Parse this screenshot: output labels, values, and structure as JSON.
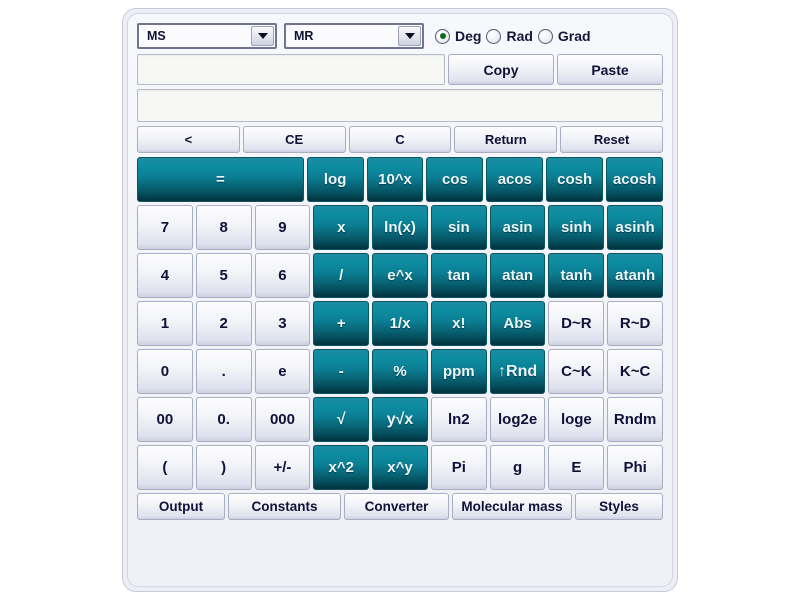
{
  "memory": {
    "store_select": {
      "value": "MS",
      "icon": "chevron-down-icon"
    },
    "recall_select": {
      "value": "MR",
      "icon": "chevron-down-icon"
    }
  },
  "angle_mode": {
    "selected": "Deg",
    "options": [
      {
        "label": "Deg",
        "selected": true
      },
      {
        "label": "Rad",
        "selected": false
      },
      {
        "label": "Grad",
        "selected": false
      }
    ]
  },
  "display": {
    "expression_value": "",
    "expression_placeholder": "",
    "result_value": "",
    "result_placeholder": ""
  },
  "clipboard": {
    "copy_label": "Copy",
    "paste_label": "Paste"
  },
  "edit_row": [
    {
      "label": "<"
    },
    {
      "label": "CE"
    },
    {
      "label": "C"
    },
    {
      "label": "Return"
    },
    {
      "label": "Reset"
    }
  ],
  "keypad": {
    "rows": [
      [
        {
          "label": "=",
          "style": "teal",
          "span": 3
        },
        {
          "label": "log",
          "style": "teal"
        },
        {
          "label": "10^x",
          "style": "teal"
        },
        {
          "label": "cos",
          "style": "teal"
        },
        {
          "label": "acos",
          "style": "teal"
        },
        {
          "label": "cosh",
          "style": "teal"
        },
        {
          "label": "acosh",
          "style": "teal"
        }
      ],
      [
        {
          "label": "7",
          "style": "light"
        },
        {
          "label": "8",
          "style": "light"
        },
        {
          "label": "9",
          "style": "light"
        },
        {
          "label": "x",
          "style": "teal"
        },
        {
          "label": "ln(x)",
          "style": "teal"
        },
        {
          "label": "sin",
          "style": "teal"
        },
        {
          "label": "asin",
          "style": "teal"
        },
        {
          "label": "sinh",
          "style": "teal"
        },
        {
          "label": "asinh",
          "style": "teal"
        }
      ],
      [
        {
          "label": "4",
          "style": "light"
        },
        {
          "label": "5",
          "style": "light"
        },
        {
          "label": "6",
          "style": "light"
        },
        {
          "label": "/",
          "style": "teal"
        },
        {
          "label": "e^x",
          "style": "teal"
        },
        {
          "label": "tan",
          "style": "teal"
        },
        {
          "label": "atan",
          "style": "teal"
        },
        {
          "label": "tanh",
          "style": "teal"
        },
        {
          "label": "atanh",
          "style": "teal"
        }
      ],
      [
        {
          "label": "1",
          "style": "light"
        },
        {
          "label": "2",
          "style": "light"
        },
        {
          "label": "3",
          "style": "light"
        },
        {
          "label": "+",
          "style": "teal"
        },
        {
          "label": "1/x",
          "style": "teal"
        },
        {
          "label": "x!",
          "style": "teal"
        },
        {
          "label": "Abs",
          "style": "teal"
        },
        {
          "label": "D~R",
          "style": "light"
        },
        {
          "label": "R~D",
          "style": "light"
        }
      ],
      [
        {
          "label": "0",
          "style": "light"
        },
        {
          "label": ".",
          "style": "light"
        },
        {
          "label": "e",
          "style": "light"
        },
        {
          "label": "-",
          "style": "teal"
        },
        {
          "label": "%",
          "style": "teal"
        },
        {
          "label": "ppm",
          "style": "teal"
        },
        {
          "label": "↑Rnd",
          "style": "teal"
        },
        {
          "label": "C~K",
          "style": "light"
        },
        {
          "label": "K~C",
          "style": "light"
        }
      ],
      [
        {
          "label": "00",
          "style": "light"
        },
        {
          "label": "0.",
          "style": "light"
        },
        {
          "label": "000",
          "style": "light"
        },
        {
          "label": "√",
          "style": "teal"
        },
        {
          "label": "y√x",
          "style": "teal"
        },
        {
          "label": "ln2",
          "style": "light"
        },
        {
          "label": "log2e",
          "style": "light"
        },
        {
          "label": "loge",
          "style": "light"
        },
        {
          "label": "Rndm",
          "style": "light"
        }
      ],
      [
        {
          "label": "(",
          "style": "light"
        },
        {
          "label": ")",
          "style": "light"
        },
        {
          "label": "+/-",
          "style": "light"
        },
        {
          "label": "x^2",
          "style": "teal"
        },
        {
          "label": "x^y",
          "style": "teal"
        },
        {
          "label": "Pi",
          "style": "light"
        },
        {
          "label": "g",
          "style": "light"
        },
        {
          "label": "E",
          "style": "light"
        },
        {
          "label": "Phi",
          "style": "light"
        }
      ]
    ]
  },
  "tabs": [
    {
      "label": "Output"
    },
    {
      "label": "Constants"
    },
    {
      "label": "Converter"
    },
    {
      "label": "Molecular mass"
    },
    {
      "label": "Styles"
    }
  ],
  "colors": {
    "teal_top": "#1d8ba0",
    "teal_bottom": "#02313c",
    "text_dark": "#101138",
    "frame": "#c9cbdd",
    "radio_dot": "#0c6a1f"
  }
}
